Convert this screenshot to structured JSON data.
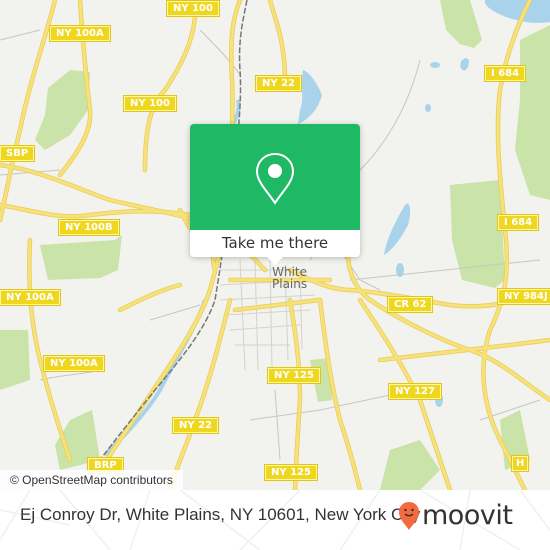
{
  "map": {
    "attribution": "© OpenStreetMap contributors",
    "city_label": [
      "White",
      "Plains"
    ],
    "road_shields": [
      {
        "id": "ny100-top",
        "label": "NY 100"
      },
      {
        "id": "ny100a-top",
        "label": "NY 100A"
      },
      {
        "id": "ny100-mid",
        "label": "NY 100"
      },
      {
        "id": "ny22-top",
        "label": "NY 22"
      },
      {
        "id": "sbp",
        "label": "SBP"
      },
      {
        "id": "i684-top",
        "label": "I 684"
      },
      {
        "id": "ny100b",
        "label": "NY 100B"
      },
      {
        "id": "i684-mid",
        "label": "I 684"
      },
      {
        "id": "ny100a-mid",
        "label": "NY 100A"
      },
      {
        "id": "cr62",
        "label": "CR 62"
      },
      {
        "id": "ny984j",
        "label": "NY 984J"
      },
      {
        "id": "ny100a-low",
        "label": "NY 100A"
      },
      {
        "id": "ny125-mid",
        "label": "NY 125"
      },
      {
        "id": "ny127",
        "label": "NY 127"
      },
      {
        "id": "ny22-low",
        "label": "NY 22"
      },
      {
        "id": "brp",
        "label": "BRP"
      },
      {
        "id": "ny125-low",
        "label": "NY 125"
      },
      {
        "id": "hrp-edge",
        "label": "H"
      }
    ],
    "colors": {
      "land": "#f2f2ee",
      "road": "#f7e17a",
      "water": "#a9d3ea",
      "park": "#c9e3a8",
      "shield": "#f0d71f"
    }
  },
  "popup": {
    "icon": "map-pin-icon",
    "button_label": "Take me there",
    "accent_color": "#1fb865"
  },
  "footer": {
    "address": "Ej Conroy Dr, White Plains, NY 10601, New York City",
    "brand_name": "moovit",
    "brand_icon": "moovit-pin-logo-icon",
    "brand_color": "#f26a3d"
  }
}
